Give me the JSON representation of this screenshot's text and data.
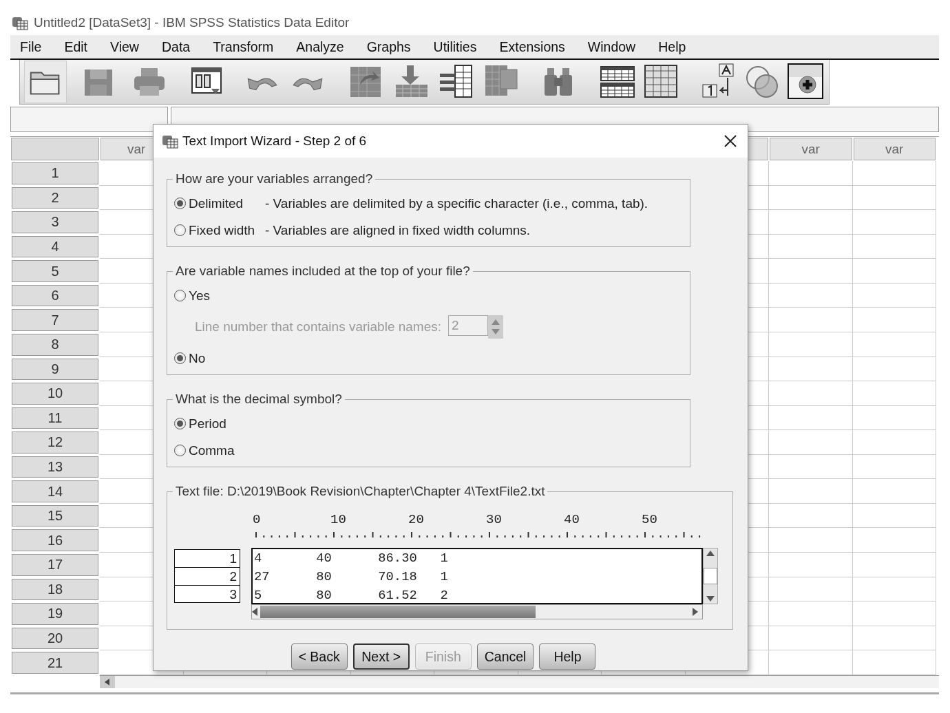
{
  "window": {
    "title": "Untitled2 [DataSet3] - IBM SPSS Statistics Data Editor"
  },
  "menu": [
    {
      "label": "File"
    },
    {
      "label": "Edit"
    },
    {
      "label": "View"
    },
    {
      "label": "Data"
    },
    {
      "label": "Transform"
    },
    {
      "label": "Analyze"
    },
    {
      "label": "Graphs"
    },
    {
      "label": "Utilities"
    },
    {
      "label": "Extensions"
    },
    {
      "label": "Window"
    },
    {
      "label": "Help"
    }
  ],
  "grid": {
    "column_headers": [
      "var",
      "var",
      "var"
    ],
    "row_numbers": [
      "1",
      "2",
      "3",
      "4",
      "5",
      "6",
      "7",
      "8",
      "9",
      "10",
      "11",
      "12",
      "13",
      "14",
      "15",
      "16",
      "17",
      "18",
      "19",
      "20",
      "21"
    ]
  },
  "dialog": {
    "title": "Text Import Wizard - Step 2 of 6",
    "groups": [
      {
        "legend": "How are your variables arranged?",
        "options": [
          {
            "label": "Delimited",
            "selected": true,
            "description": "- Variables are delimited by a specific character (i.e., comma, tab)."
          },
          {
            "label": "Fixed width",
            "selected": false,
            "description": "- Variables are aligned in fixed width columns."
          }
        ]
      },
      {
        "legend": "Are variable names included at the top of your file?",
        "options": [
          {
            "label": "Yes",
            "selected": false
          },
          {
            "label": "No",
            "selected": true
          }
        ],
        "line_number": {
          "label": "Line number that contains variable names:",
          "value": "2",
          "disabled": true
        }
      },
      {
        "legend": "What is the decimal symbol?",
        "options": [
          {
            "label": "Period",
            "selected": true
          },
          {
            "label": "Comma",
            "selected": false
          }
        ]
      }
    ],
    "preview": {
      "legend": "Text file:  D:\\2019\\Book Revision\\Chapter\\Chapter 4\\TextFile2.txt",
      "ruler": [
        "0",
        "10",
        "20",
        "30",
        "40",
        "50"
      ],
      "rows": [
        {
          "number": "1",
          "line": "4       40      86.30   1"
        },
        {
          "number": "2",
          "line": "27      80      70.18   1"
        },
        {
          "number": "3",
          "line": "5       80      61.52   2"
        }
      ]
    },
    "buttons": [
      {
        "label": "< Back",
        "disabled": false,
        "default": false
      },
      {
        "label": "Next >",
        "disabled": false,
        "default": true
      },
      {
        "label": "Finish",
        "disabled": true,
        "default": false
      },
      {
        "label": "Cancel",
        "disabled": false,
        "default": false
      },
      {
        "label": "Help",
        "disabled": false,
        "default": false
      }
    ]
  }
}
